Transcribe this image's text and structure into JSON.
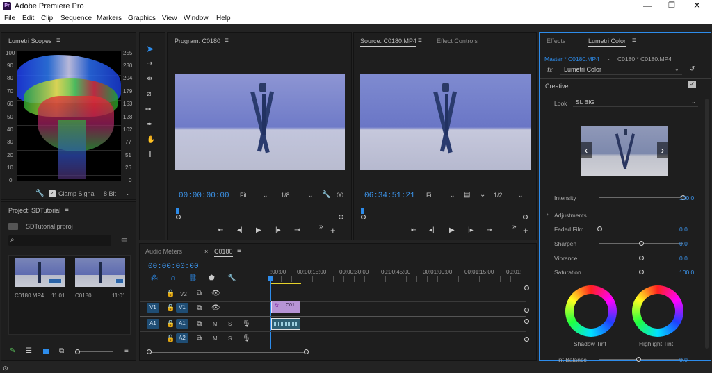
{
  "app": {
    "title": "Adobe Premiere Pro",
    "logo": "Pr"
  },
  "menu": [
    "File",
    "Edit",
    "Clip",
    "Sequence",
    "Markers",
    "Graphics",
    "View",
    "Window",
    "Help"
  ],
  "scopes": {
    "title": "Lumetri Scopes",
    "left_ticks": [
      "100",
      "90",
      "80",
      "70",
      "60",
      "50",
      "40",
      "30",
      "20",
      "10",
      "0"
    ],
    "right_ticks": [
      "255",
      "230",
      "204",
      "179",
      "153",
      "128",
      "102",
      "77",
      "51",
      "26",
      "0"
    ],
    "clamp_label": "Clamp Signal",
    "bit_depth": "8 Bit"
  },
  "project": {
    "title": "Project: SDTutorial",
    "file": "SDTutorial.prproj",
    "items": [
      {
        "name": "C0180.MP4",
        "duration": "11:01"
      },
      {
        "name": "C0180",
        "duration": "11:01"
      }
    ]
  },
  "program": {
    "title": "Program: C0180",
    "timecode": "00:00:00:00",
    "fit": "Fit",
    "resolution": "1/8",
    "end_value": "00"
  },
  "source": {
    "tab_active": "Source: C0180.MP4",
    "tab_inactive": "Effect Controls",
    "timecode": "06:34:51:21",
    "fit": "Fit",
    "resolution": "1/2"
  },
  "timeline": {
    "tab_audio_meters": "Audio Meters",
    "tab_sequence": "C0180",
    "timecode": "00:00:00:00",
    "ruler": [
      ":00:00",
      "00:00:15:00",
      "00:00:30:00",
      "00:00:45:00",
      "00:01:00:00",
      "00:01:15:00",
      "00:01:"
    ],
    "tracks": [
      {
        "source": "",
        "name": "V2",
        "m": "",
        "s": ""
      },
      {
        "source": "V1",
        "name": "V1",
        "m": "",
        "s": ""
      },
      {
        "source": "A1",
        "name": "A1",
        "m": "M",
        "s": "S"
      },
      {
        "source": "",
        "name": "A2",
        "m": "M",
        "s": "S"
      }
    ],
    "clip_label": "C01",
    "clip_fx": "fx"
  },
  "lumetri": {
    "tab_effects": "Effects",
    "tab_lumetri": "Lumetri Color",
    "master": "Master * C0180.MP4",
    "sequence_clip": "C0180 * C0180.MP4",
    "fx": "fx",
    "effect_name": "Lumetri Color",
    "section_creative": "Creative",
    "look_label": "Look",
    "look_value": "SL BIG",
    "intensity_label": "Intensity",
    "intensity_value": "100.0",
    "intensity": 1.0,
    "adjustments_label": "Adjustments",
    "sliders": [
      {
        "label": "Faded Film",
        "value": "0.0",
        "level": 0.0
      },
      {
        "label": "Sharpen",
        "value": "0.0",
        "level": 0.5
      },
      {
        "label": "Vibrance",
        "value": "0.0",
        "level": 0.5
      },
      {
        "label": "Saturation",
        "value": "100.0",
        "level": 0.5
      }
    ],
    "wheel_shadow": "Shadow Tint",
    "wheel_highlight": "Highlight Tint",
    "tint_balance_label": "Tint Balance",
    "tint_balance_value": "0.0"
  },
  "colors": {
    "accent": "#2d8ceb",
    "panel": "#1e1e1e",
    "track_blue": "#1f4d74",
    "clip_purple": "#b794d6"
  }
}
